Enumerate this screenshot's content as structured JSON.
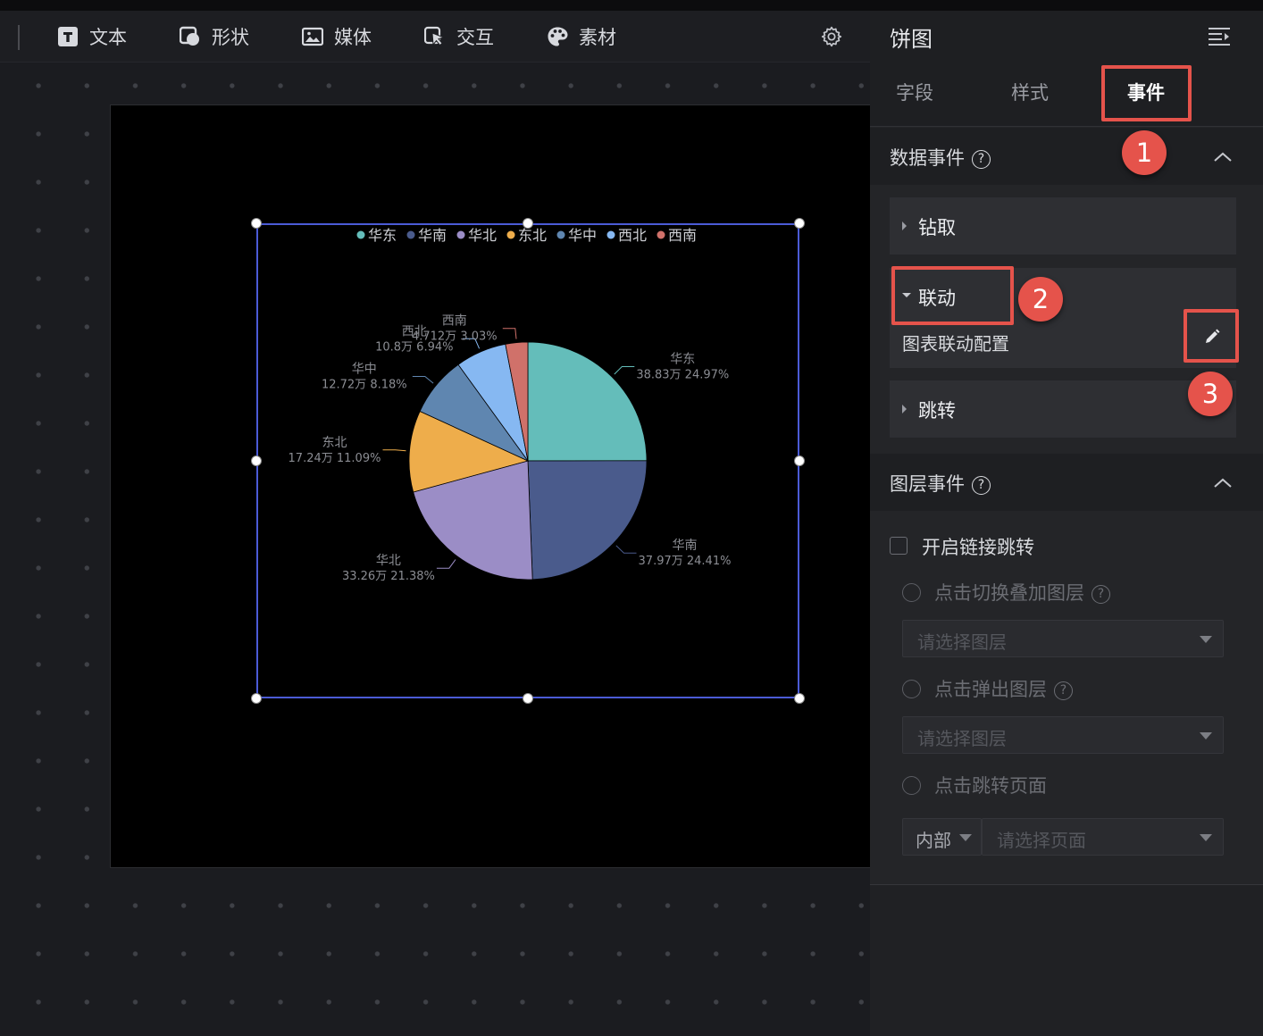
{
  "toolbar": {
    "items": [
      {
        "label": "文本",
        "icon": "text-icon"
      },
      {
        "label": "形状",
        "icon": "shape-icon"
      },
      {
        "label": "媒体",
        "icon": "image-icon"
      },
      {
        "label": "交互",
        "icon": "interaction-icon"
      },
      {
        "label": "素材",
        "icon": "palette-icon"
      }
    ],
    "settings_icon": "gear-icon"
  },
  "panel": {
    "title": "饼图",
    "tabs": [
      "字段",
      "样式",
      "事件"
    ],
    "active_tab": "事件",
    "data_events": {
      "title": "数据事件",
      "help": "?",
      "items": {
        "drill": "钻取",
        "linkage": "联动",
        "linkage_config": "图表联动配置",
        "jump": "跳转"
      }
    },
    "layer_events": {
      "title": "图层事件",
      "help": "?",
      "enable_link": "开启链接跳转",
      "option_switch": "点击切换叠加图层",
      "option_switch_help": "?",
      "option_switch_placeholder": "请选择图层",
      "option_popup": "点击弹出图层",
      "option_popup_help": "?",
      "option_popup_placeholder": "请选择图层",
      "option_page": "点击跳转页面",
      "page_scope": "内部",
      "page_placeholder": "请选择页面"
    }
  },
  "annotations": {
    "step1": "1",
    "step2": "2",
    "step3": "3"
  },
  "colors": {
    "accent_red": "#e5534b",
    "selection_blue": "#4b5bd6",
    "series": [
      "#64bdba",
      "#4a5b8c",
      "#9b8dc6",
      "#eead4b",
      "#5f86b0",
      "#86b8f2",
      "#d0716a"
    ]
  },
  "chart_data": {
    "type": "pie",
    "legend": [
      "华东",
      "华南",
      "华北",
      "东北",
      "华中",
      "西北",
      "西南"
    ],
    "legend_position": "top",
    "slices": [
      {
        "name": "华东",
        "value_label": "38.83万",
        "percent": 24.97,
        "percent_label": "24.97%"
      },
      {
        "name": "华南",
        "value_label": "37.97万",
        "percent": 24.41,
        "percent_label": "24.41%"
      },
      {
        "name": "华北",
        "value_label": "33.26万",
        "percent": 21.38,
        "percent_label": "21.38%"
      },
      {
        "name": "东北",
        "value_label": "17.24万",
        "percent": 11.09,
        "percent_label": "11.09%"
      },
      {
        "name": "华中",
        "value_label": "12.72万",
        "percent": 8.18,
        "percent_label": "8.18%"
      },
      {
        "name": "西北",
        "value_label": "10.8万",
        "percent": 6.94,
        "percent_label": "6.94%"
      },
      {
        "name": "西南",
        "value_label": "4.712万",
        "percent": 3.03,
        "percent_label": "3.03%"
      }
    ]
  }
}
